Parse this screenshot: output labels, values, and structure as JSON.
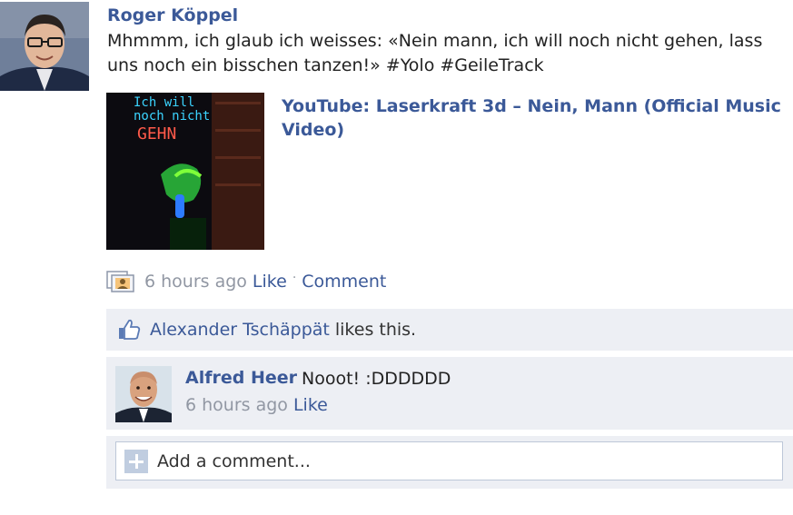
{
  "post": {
    "author": "Roger Köppel",
    "text": "Mhmmm, ich glaub ich weisses: «Nein mann, ich will noch nicht gehen, lass uns noch ein bisschen tanzen!» #Yolo #GeileTrack",
    "link": {
      "title": "YouTube: Laserkraft 3d – Nein, Mann (Official Music Video)",
      "thumbnail_text": [
        "Ich will",
        "noch nicht",
        "GEHN"
      ]
    },
    "time": "6 hours ago",
    "like_label": "Like",
    "separator": "·",
    "comment_label": "Comment"
  },
  "likes": {
    "person": "Alexander Tschäppät",
    "suffix": "likes this."
  },
  "comments": [
    {
      "author": "Alfred Heer",
      "text": "Nooot! :DDDDDD",
      "time": "6 hours ago",
      "like_label": "Like"
    }
  ],
  "add_comment": {
    "placeholder": "Add a comment..."
  },
  "colors": {
    "link_blue": "#3b5998",
    "meta_grey": "#9197a3",
    "ufi_background": "#edeff4"
  }
}
